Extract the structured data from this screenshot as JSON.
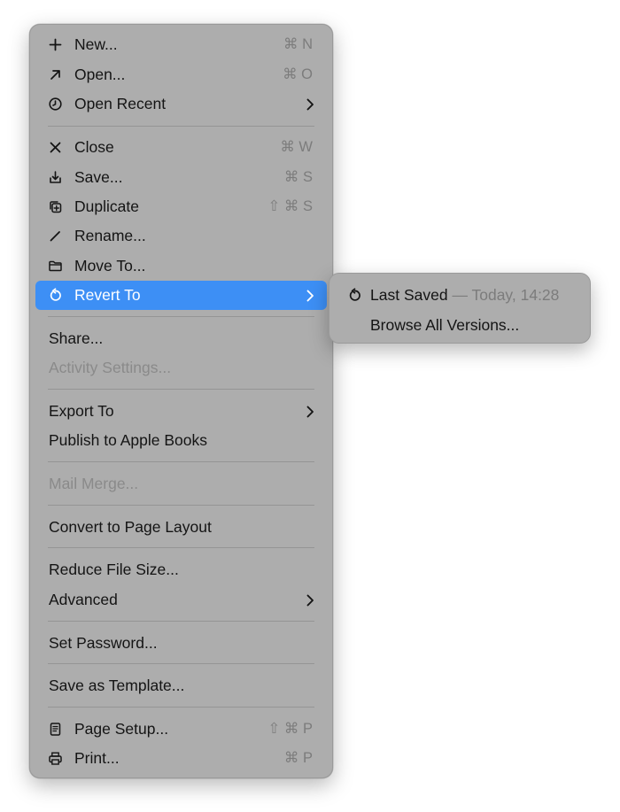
{
  "menu": {
    "new": {
      "label": "New...",
      "shortcut": "⌘ N"
    },
    "open": {
      "label": "Open...",
      "shortcut": "⌘ O"
    },
    "open_recent": {
      "label": "Open Recent"
    },
    "close": {
      "label": "Close",
      "shortcut": "⌘ W"
    },
    "save": {
      "label": "Save...",
      "shortcut": "⌘ S"
    },
    "duplicate": {
      "label": "Duplicate",
      "shortcut": "⇧ ⌘ S"
    },
    "rename": {
      "label": "Rename..."
    },
    "move_to": {
      "label": "Move To..."
    },
    "revert_to": {
      "label": "Revert To"
    },
    "share": {
      "label": "Share..."
    },
    "activity_settings": {
      "label": "Activity Settings..."
    },
    "export_to": {
      "label": "Export To"
    },
    "publish": {
      "label": "Publish to Apple Books"
    },
    "mail_merge": {
      "label": "Mail Merge..."
    },
    "convert": {
      "label": "Convert to Page Layout"
    },
    "reduce": {
      "label": "Reduce File Size..."
    },
    "advanced": {
      "label": "Advanced"
    },
    "set_password": {
      "label": "Set Password..."
    },
    "save_template": {
      "label": "Save as Template..."
    },
    "page_setup": {
      "label": "Page Setup...",
      "shortcut": "⇧ ⌘ P"
    },
    "print": {
      "label": "Print...",
      "shortcut": "⌘ P"
    }
  },
  "submenu": {
    "last_saved": {
      "label": "Last Saved",
      "detail": "— Today, 14:28"
    },
    "browse": {
      "label": "Browse All Versions..."
    }
  },
  "colors": {
    "menu_bg": "#adadad",
    "highlight": "#3d8ff5",
    "text": "#141414",
    "disabled": "#8a8a8a"
  }
}
